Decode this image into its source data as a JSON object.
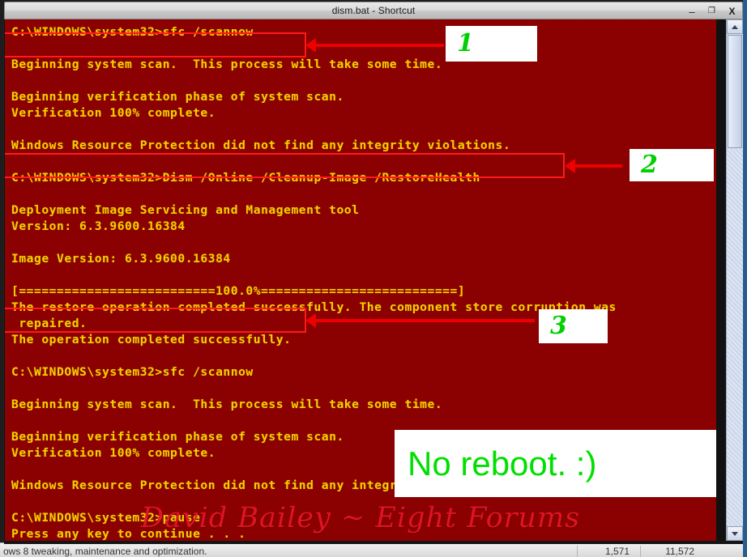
{
  "window": {
    "title": "dism.bat - Shortcut",
    "controls": [
      {
        "name": "minimize",
        "glyph": "–"
      },
      {
        "name": "maximize",
        "glyph": "❐"
      },
      {
        "name": "close",
        "glyph": "X"
      }
    ]
  },
  "console": {
    "background_color": "#8b0000",
    "text_color": "#f0d000",
    "lines": [
      "C:\\WINDOWS\\system32>sfc /scannow",
      "",
      "Beginning system scan.  This process will take some time.",
      "",
      "Beginning verification phase of system scan.",
      "Verification 100% complete.",
      "",
      "Windows Resource Protection did not find any integrity violations.",
      "",
      "C:\\WINDOWS\\system32>Dism /Online /Cleanup-Image /RestoreHealth",
      "",
      "Deployment Image Servicing and Management tool",
      "Version: 6.3.9600.16384",
      "",
      "Image Version: 6.3.9600.16384",
      "",
      "[==========================100.0%==========================]",
      "The restore operation completed successfully. The component store corruption was",
      " repaired.",
      "The operation completed successfully.",
      "",
      "C:\\WINDOWS\\system32>sfc /scannow",
      "",
      "Beginning system scan.  This process will take some time.",
      "",
      "Beginning verification phase of system scan.",
      "Verification 100% complete.",
      "",
      "Windows Resource Protection did not find any integrity violations.",
      "",
      "C:\\WINDOWS\\system32>pause",
      "Press any key to continue . . ."
    ]
  },
  "annotations": {
    "highlight_color": "#ff1a1a",
    "callout_text_color": "#00d000",
    "steps": [
      {
        "label": "1",
        "target": "sfc /scannow (first run)"
      },
      {
        "label": "2",
        "target": "Dism /Online /Cleanup-Image /RestoreHealth"
      },
      {
        "label": "3",
        "target": "sfc /scannow (second run)"
      }
    ],
    "note": "No reboot. :)"
  },
  "watermark": {
    "text": "David Bailey ~ Eight Forums",
    "color": "#e8152a"
  },
  "background_statusbar": {
    "left_text": "ows 8 tweaking, maintenance and optimization.",
    "col1": "1,571",
    "col2": "11,572"
  },
  "scrollbar": {
    "up_arrow": "▲",
    "down_arrow": "▼"
  }
}
